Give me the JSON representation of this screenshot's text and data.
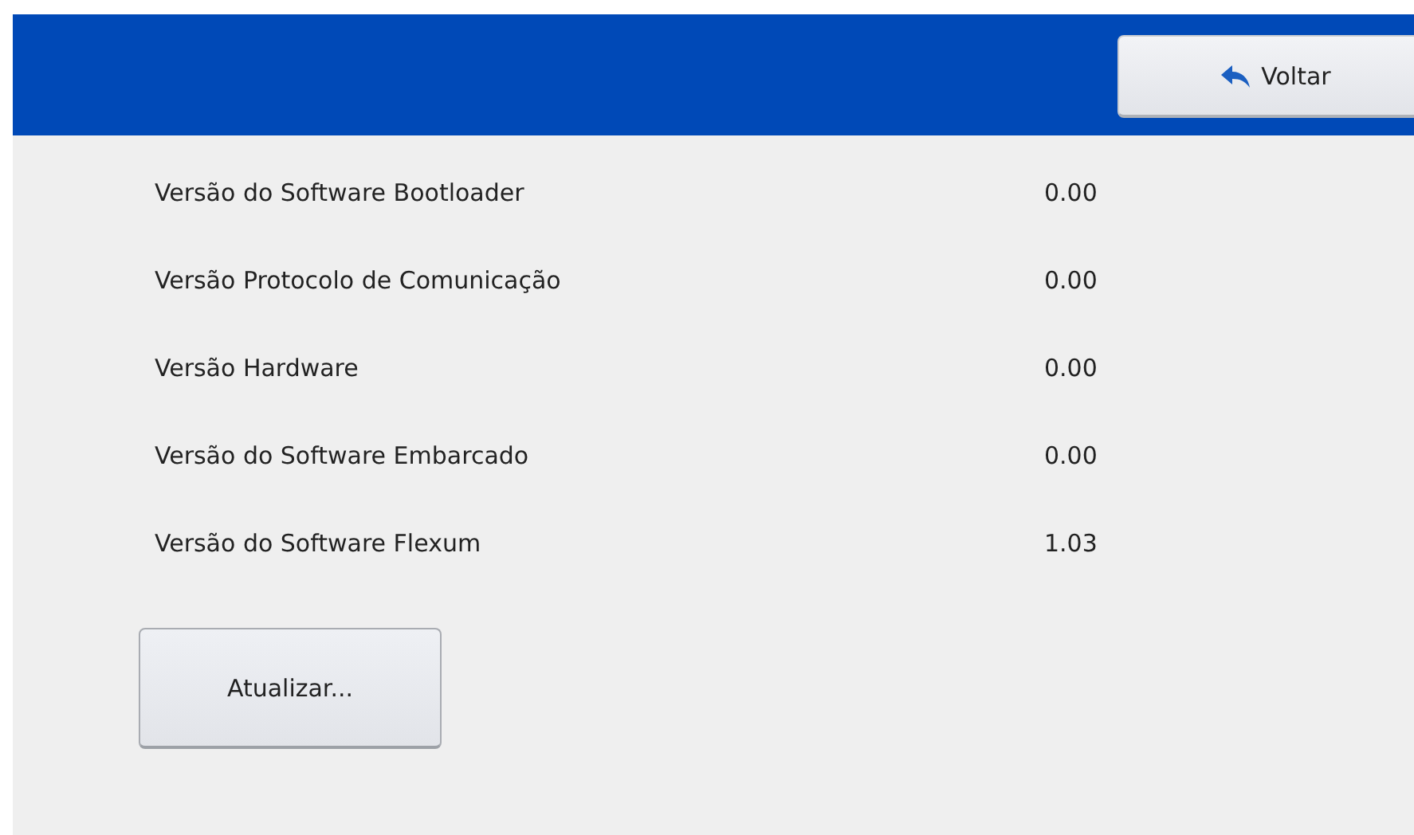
{
  "header": {
    "back_button": {
      "label": "Voltar"
    }
  },
  "versions": [
    {
      "label": "Versão do Software Bootloader",
      "value": "0.00"
    },
    {
      "label": "Versão Protocolo de Comunicação",
      "value": "0.00"
    },
    {
      "label": "Versão Hardware",
      "value": "0.00"
    },
    {
      "label": "Versão do Software Embarcado",
      "value": "0.00"
    },
    {
      "label": "Versão do Software Flexum",
      "value": "1.03"
    }
  ],
  "update_button": {
    "label": "Atualizar..."
  }
}
